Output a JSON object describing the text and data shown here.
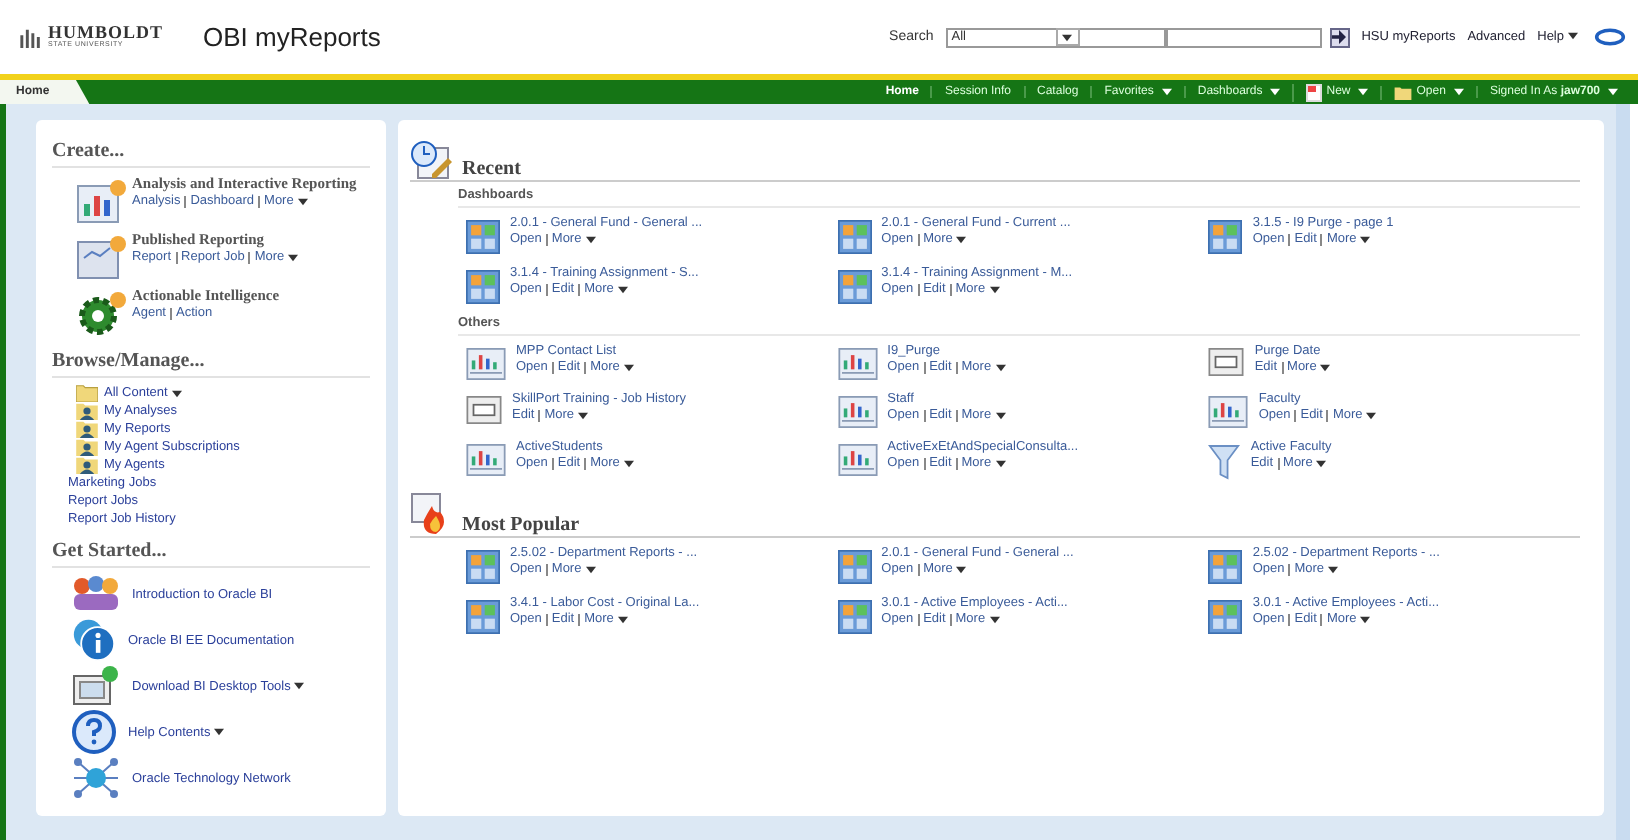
{
  "header": {
    "logo_name": "HUMBOLDT",
    "logo_sub": "STATE UNIVERSITY",
    "title": "OBI myReports",
    "search_label": "Search",
    "search_scope": "All",
    "links": [
      {
        "label": "HSU myReports",
        "menu": false
      },
      {
        "label": "Advanced",
        "menu": false
      },
      {
        "label": "Help",
        "menu": true
      }
    ]
  },
  "tab": {
    "label": "Home",
    "selected": true
  },
  "nav": [
    {
      "label": "Home",
      "selected": true,
      "menu": false,
      "kind": "plain"
    },
    {
      "label": "Session Info",
      "selected": false,
      "menu": false,
      "kind": "plain"
    },
    {
      "label": "Catalog",
      "selected": false,
      "menu": false,
      "kind": "plain"
    },
    {
      "label": "Favorites",
      "selected": false,
      "menu": true,
      "kind": "plain"
    },
    {
      "label": "Dashboards",
      "selected": false,
      "menu": true,
      "kind": "plain"
    },
    {
      "label": "New",
      "selected": false,
      "menu": true,
      "kind": "new"
    },
    {
      "label": "Open",
      "selected": false,
      "menu": true,
      "kind": "folder"
    },
    {
      "label": "Signed In As **jaw700**",
      "selected": false,
      "menu": true,
      "kind": "plain"
    }
  ],
  "sidebar": {
    "sections": [
      {
        "title": "Create...",
        "kind": "create",
        "items": [
          {
            "kind": "analysis",
            "title": "Analysis and Interactive Reporting",
            "actions": [
              {
                "label": "Analysis",
                "menu": false
              },
              {
                "label": "Dashboard",
                "menu": false
              },
              {
                "label": "More",
                "menu": true
              }
            ]
          },
          {
            "kind": "published",
            "title": "Published Reporting",
            "actions": [
              {
                "label": "Report",
                "menu": false
              },
              {
                "label": "Report Job",
                "menu": false
              },
              {
                "label": "More",
                "menu": true
              }
            ]
          },
          {
            "kind": "agent",
            "title": "Actionable Intelligence",
            "actions": [
              {
                "label": "Agent",
                "menu": false
              },
              {
                "label": "Action",
                "menu": false
              }
            ]
          }
        ]
      },
      {
        "title": "Browse/Manage...",
        "kind": "browse",
        "items": [
          {
            "kind": "folder",
            "label": "All Content",
            "menu": true
          },
          {
            "kind": "user-folder",
            "label": "My Analyses",
            "menu": false
          },
          {
            "kind": "user-folder",
            "label": "My Reports",
            "menu": false
          },
          {
            "kind": "user-folder",
            "label": "My Agent Subscriptions",
            "menu": false
          },
          {
            "kind": "user-folder",
            "label": "My Agents",
            "menu": false
          },
          {
            "kind": "link",
            "label": "Marketing Jobs",
            "menu": false
          },
          {
            "kind": "link",
            "label": "Report Jobs",
            "menu": false
          },
          {
            "kind": "link",
            "label": "Report Job History",
            "menu": false
          }
        ]
      },
      {
        "title": "Get Started...",
        "kind": "start",
        "items": [
          {
            "kind": "intro",
            "label": "Introduction to Oracle BI",
            "menu": false
          },
          {
            "kind": "docs",
            "label": "Oracle BI EE Documentation",
            "menu": false
          },
          {
            "kind": "download",
            "label": "Download BI Desktop Tools",
            "menu": true
          },
          {
            "kind": "help",
            "label": "Help Contents",
            "menu": true
          },
          {
            "kind": "network",
            "label": "Oracle Technology Network",
            "menu": false
          }
        ]
      }
    ]
  },
  "main": {
    "sections": [
      {
        "title": "Recent",
        "kind": "recent",
        "groups": [
          {
            "title": "Dashboards",
            "items": [
              {
                "kind": "dashboard",
                "title": "2.0.1 - General Fund - General ...",
                "actions": [
                  {
                    "label": "Open",
                    "menu": false
                  },
                  {
                    "label": "More",
                    "menu": true
                  }
                ]
              },
              {
                "kind": "dashboard",
                "title": "2.0.1 - General Fund - Current ...",
                "actions": [
                  {
                    "label": "Open",
                    "menu": false
                  },
                  {
                    "label": "More",
                    "menu": true
                  }
                ]
              },
              {
                "kind": "dashboard",
                "title": "3.1.5 - I9 Purge - page 1",
                "actions": [
                  {
                    "label": "Open",
                    "menu": false
                  },
                  {
                    "label": "Edit",
                    "menu": false
                  },
                  {
                    "label": "More",
                    "menu": true
                  }
                ]
              },
              {
                "kind": "dashboard",
                "title": "3.1.4 - Training Assignment - S...",
                "actions": [
                  {
                    "label": "Open",
                    "menu": false
                  },
                  {
                    "label": "Edit",
                    "menu": false
                  },
                  {
                    "label": "More",
                    "menu": true
                  }
                ]
              },
              {
                "kind": "dashboard",
                "title": "3.1.4 - Training Assignment - M...",
                "actions": [
                  {
                    "label": "Open",
                    "menu": false
                  },
                  {
                    "label": "Edit",
                    "menu": false
                  },
                  {
                    "label": "More",
                    "menu": true
                  }
                ]
              }
            ]
          },
          {
            "title": "Others",
            "items": [
              {
                "kind": "analysis",
                "title": "MPP Contact List",
                "actions": [
                  {
                    "label": "Open",
                    "menu": false
                  },
                  {
                    "label": "Edit",
                    "menu": false
                  },
                  {
                    "label": "More",
                    "menu": true
                  }
                ]
              },
              {
                "kind": "analysis",
                "title": "I9_Purge",
                "actions": [
                  {
                    "label": "Open",
                    "menu": false
                  },
                  {
                    "label": "Edit",
                    "menu": false
                  },
                  {
                    "label": "More",
                    "menu": true
                  }
                ]
              },
              {
                "kind": "prompt",
                "title": "Purge Date",
                "actions": [
                  {
                    "label": "Edit",
                    "menu": false
                  },
                  {
                    "label": "More",
                    "menu": true
                  }
                ]
              },
              {
                "kind": "prompt",
                "title": "SkillPort Training - Job History",
                "actions": [
                  {
                    "label": "Edit",
                    "menu": false
                  },
                  {
                    "label": "More",
                    "menu": true
                  }
                ]
              },
              {
                "kind": "analysis",
                "title": "Staff",
                "actions": [
                  {
                    "label": "Open",
                    "menu": false
                  },
                  {
                    "label": "Edit",
                    "menu": false
                  },
                  {
                    "label": "More",
                    "menu": true
                  }
                ]
              },
              {
                "kind": "analysis",
                "title": "Faculty",
                "actions": [
                  {
                    "label": "Open",
                    "menu": false
                  },
                  {
                    "label": "Edit",
                    "menu": false
                  },
                  {
                    "label": "More",
                    "menu": true
                  }
                ]
              },
              {
                "kind": "analysis",
                "title": "ActiveStudents",
                "actions": [
                  {
                    "label": "Open",
                    "menu": false
                  },
                  {
                    "label": "Edit",
                    "menu": false
                  },
                  {
                    "label": "More",
                    "menu": true
                  }
                ]
              },
              {
                "kind": "analysis",
                "title": "ActiveExEtAndSpecialConsulta...",
                "actions": [
                  {
                    "label": "Open",
                    "menu": false
                  },
                  {
                    "label": "Edit",
                    "menu": false
                  },
                  {
                    "label": "More",
                    "menu": true
                  }
                ]
              },
              {
                "kind": "filter",
                "title": "Active Faculty",
                "actions": [
                  {
                    "label": "Edit",
                    "menu": false
                  },
                  {
                    "label": "More",
                    "menu": true
                  }
                ]
              }
            ]
          }
        ]
      },
      {
        "title": "Most Popular",
        "kind": "popular",
        "groups": [
          {
            "items": [
              {
                "kind": "dashboard",
                "title": "2.5.02 - Department Reports - ...",
                "actions": [
                  {
                    "label": "Open",
                    "menu": false
                  },
                  {
                    "label": "More",
                    "menu": true
                  }
                ]
              },
              {
                "kind": "dashboard",
                "title": "2.0.1 - General Fund - General ...",
                "actions": [
                  {
                    "label": "Open",
                    "menu": false
                  },
                  {
                    "label": "More",
                    "menu": true
                  }
                ]
              },
              {
                "kind": "dashboard",
                "title": "2.5.02 - Department Reports - ...",
                "actions": [
                  {
                    "label": "Open",
                    "menu": false
                  },
                  {
                    "label": "More",
                    "menu": true
                  }
                ]
              },
              {
                "kind": "dashboard",
                "title": "3.4.1 - Labor Cost - Original La...",
                "actions": [
                  {
                    "label": "Open",
                    "menu": false
                  },
                  {
                    "label": "Edit",
                    "menu": false
                  },
                  {
                    "label": "More",
                    "menu": true
                  }
                ]
              },
              {
                "kind": "dashboard",
                "title": "3.0.1 - Active Employees - Acti...",
                "actions": [
                  {
                    "label": "Open",
                    "menu": false
                  },
                  {
                    "label": "Edit",
                    "menu": false
                  },
                  {
                    "label": "More",
                    "menu": true
                  }
                ]
              },
              {
                "kind": "dashboard",
                "title": "3.0.1 - Active Employees - Acti...",
                "actions": [
                  {
                    "label": "Open",
                    "menu": false
                  },
                  {
                    "label": "Edit",
                    "menu": false
                  },
                  {
                    "label": "More",
                    "menu": true
                  }
                ]
              }
            ]
          }
        ]
      }
    ]
  }
}
